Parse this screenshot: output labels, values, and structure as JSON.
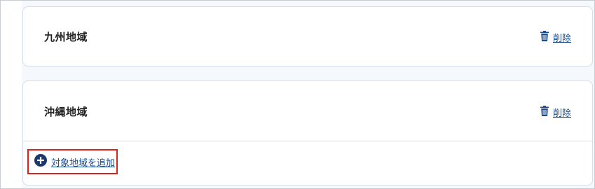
{
  "regions": [
    {
      "name": "九州地域",
      "delete_label": "削除"
    },
    {
      "name": "沖縄地域",
      "delete_label": "削除"
    }
  ],
  "add_region": {
    "label": "対象地域を追加"
  },
  "icons": {
    "delete": "trash-icon",
    "add": "plus-circle-icon"
  },
  "colors": {
    "link": "#1a4b8c",
    "highlight_border": "#d9231f"
  }
}
